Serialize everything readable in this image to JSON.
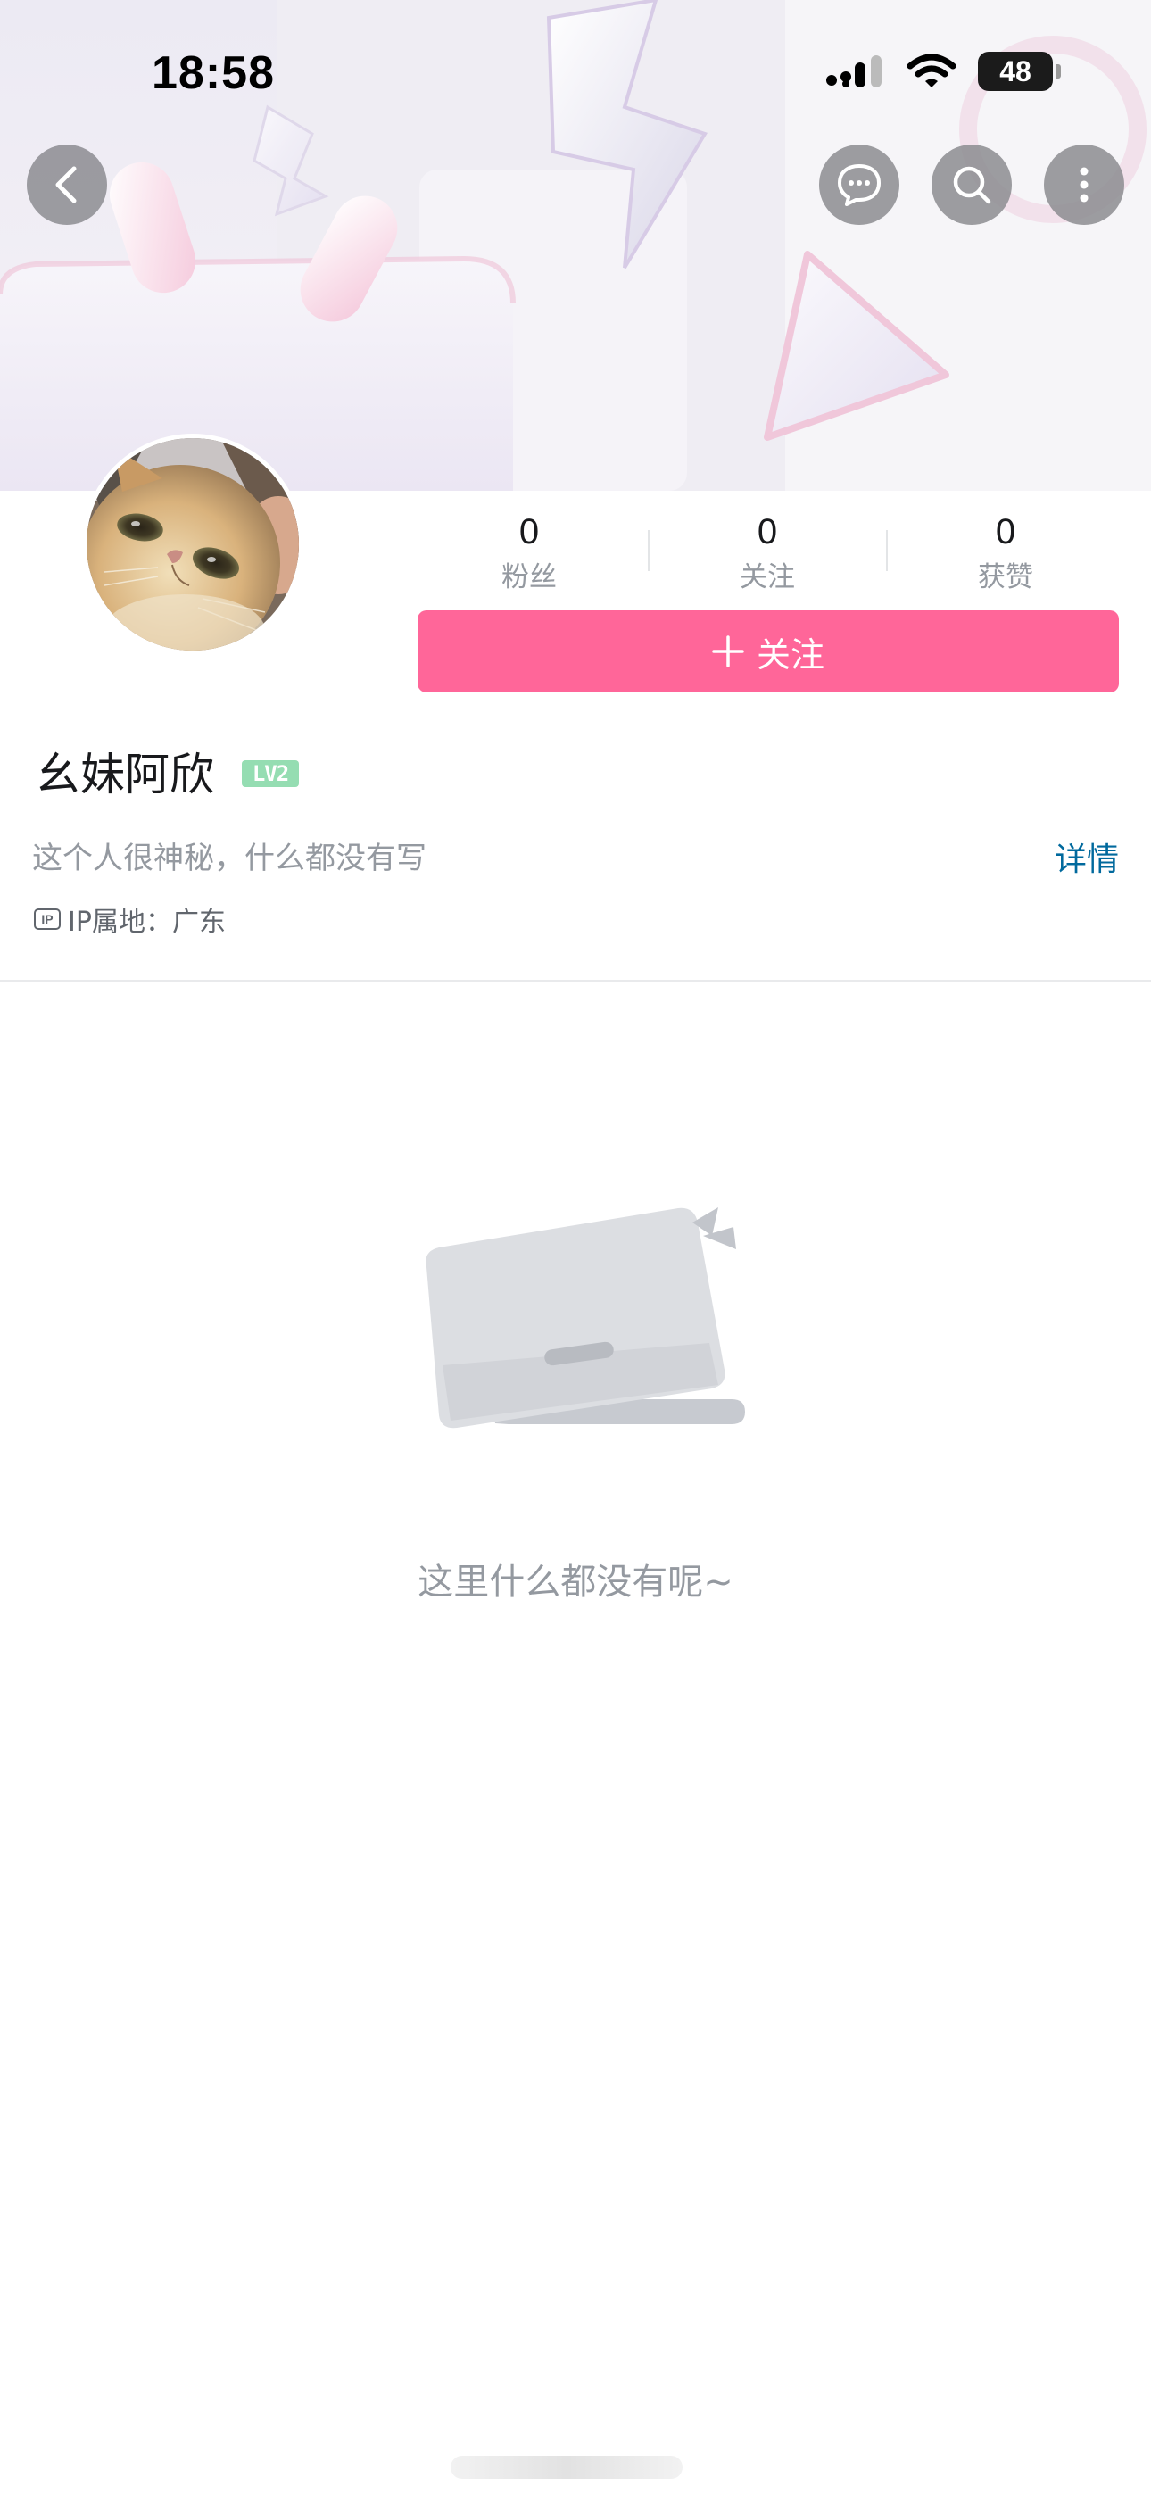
{
  "status_bar": {
    "time": "18:58",
    "battery": "48"
  },
  "header": {
    "back_icon": "chevron-left-icon",
    "message_icon": "chat-bubble-icon",
    "search_icon": "search-icon",
    "more_icon": "more-vertical-icon"
  },
  "profile": {
    "username": "幺妹阿欣",
    "level": "LV2",
    "bio": "这个人很神秘，什么都没有写",
    "detail_link": "详情",
    "ip_location": "IP属地：广东",
    "stats": [
      {
        "value": "0",
        "label": "粉丝"
      },
      {
        "value": "0",
        "label": "关注"
      },
      {
        "value": "0",
        "label": "获赞"
      }
    ],
    "follow_button": "关注",
    "follow_icon": "plus-icon"
  },
  "empty_state": {
    "text": "这里什么都没有呢~"
  },
  "colors": {
    "accent": "#ff6699",
    "link": "#00699d",
    "level_badge": "#95ddb2",
    "muted_text": "#9499a0"
  }
}
